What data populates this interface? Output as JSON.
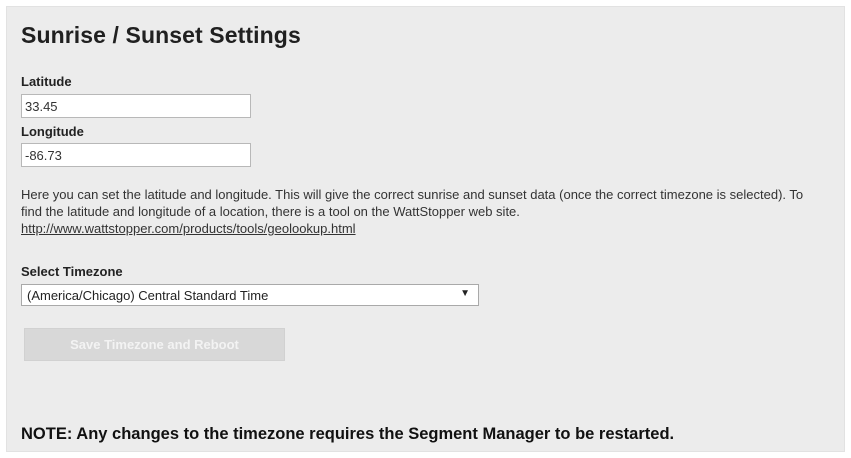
{
  "page": {
    "title": "Sunrise / Sunset Settings"
  },
  "latitude": {
    "label": "Latitude",
    "value": "33.45"
  },
  "longitude": {
    "label": "Longitude",
    "value": "-86.73"
  },
  "help": {
    "text": "Here you can set the latitude and longitude. This will give the correct sunrise and sunset data (once the correct timezone is selected). To find the latitude and longitude of a location, there is a tool on the WattStopper web site.",
    "link_text": "http://www.wattstopper.com/products/tools/geolookup.html"
  },
  "timezone": {
    "label": "Select Timezone",
    "selected": "(America/Chicago) Central Standard Time",
    "arrow_icon": "dropdown-arrow-icon"
  },
  "actions": {
    "save_label": "Save Timezone and Reboot"
  },
  "note": {
    "text": "NOTE: Any changes to the timezone requires the Segment Manager to be restarted."
  },
  "colors": {
    "panel_background": "#ececec",
    "button_disabled": "#d8d8d8"
  }
}
